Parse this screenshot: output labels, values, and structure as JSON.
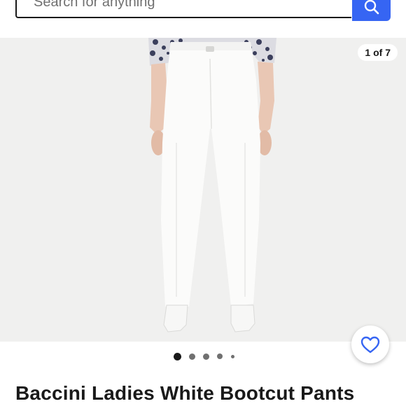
{
  "search": {
    "placeholder": "Search for anything",
    "button_icon": "search-icon"
  },
  "gallery": {
    "counter": "1 of 7",
    "total_images": 7,
    "current_index": 1,
    "visible_dot_count": 5
  },
  "favorite": {
    "icon": "heart-icon"
  },
  "product": {
    "title": "Baccini Ladies White Bootcut Pants"
  },
  "colors": {
    "accent": "#3665f3",
    "text": "#191919",
    "gallery_bg": "#f0f0ef"
  }
}
